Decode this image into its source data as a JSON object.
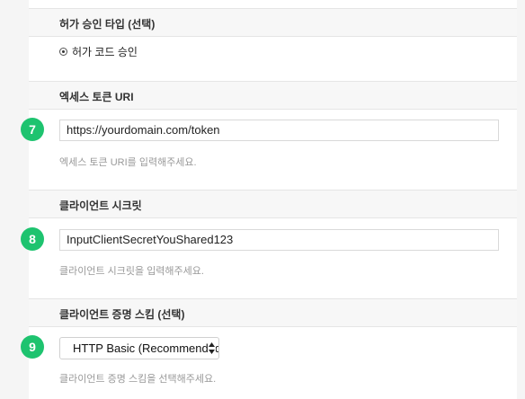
{
  "sections": {
    "grant_type": {
      "header": "허가 승인 타입 (선택)",
      "option_label": "허가 코드 승인"
    },
    "token_uri": {
      "step": "7",
      "header": "엑세스 토큰 URI",
      "value": "https://yourdomain.com/token",
      "helper": "엑세스 토큰 URI를 입력해주세요."
    },
    "client_secret": {
      "step": "8",
      "header": "클라이언트 시크릿",
      "value": "InputClientSecretYouShared123",
      "helper": "클라이언트 시크릿을 입력해주세요."
    },
    "auth_scheme": {
      "step": "9",
      "header": "클라이언트 증명 스킴 (선택)",
      "selected": "HTTP Basic (Recommended)",
      "helper": "클라이언트 증명 스킴을 선택해주세요."
    }
  },
  "colors": {
    "step_badge": "#1ec36f",
    "header_bg": "#f7f7f7",
    "helper_text": "#999999"
  },
  "icons": {
    "select_arrows": "updown-arrows-icon",
    "radio": "radio-selected"
  }
}
